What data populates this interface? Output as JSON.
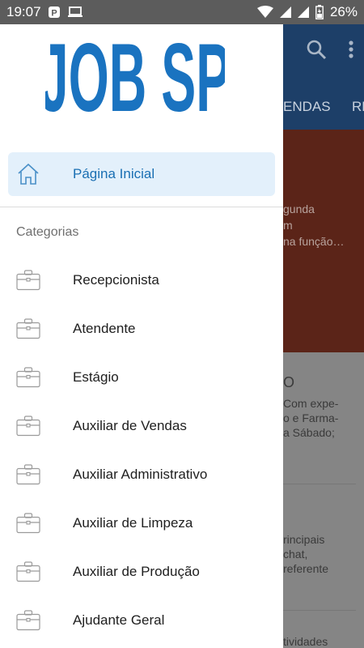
{
  "status_bar": {
    "time": "19:07",
    "battery": "26%",
    "icons": [
      "p-icon",
      "monitor-icon",
      "wifi-icon",
      "signal-icon",
      "signal-icon",
      "battery-icon"
    ]
  },
  "background_app": {
    "tabs": [
      "ENDAS",
      "RE"
    ],
    "hero_lines": [
      "gunda",
      "m",
      "na função…"
    ],
    "card1_lines": [
      "O",
      "Com expe-",
      "o e Farma-",
      "a Sábado;"
    ],
    "card2_lines": [
      "rincipais",
      "chat,",
      "referente"
    ],
    "card3_lines": [
      "tividades"
    ],
    "toolbar_icons": [
      "search-icon",
      "more-vert-icon"
    ]
  },
  "drawer": {
    "logo_text": "JOB SP",
    "logo_color": "#1a73c0",
    "home_label": "Página Inicial",
    "section_title": "Categorias",
    "categories": [
      "Recepcionista",
      "Atendente",
      "Estágio",
      "Auxiliar de Vendas",
      "Auxiliar Administrativo",
      "Auxiliar de Limpeza",
      "Auxiliar de Produção",
      "Ajudante Geral"
    ],
    "accent": "#1a6fb3",
    "highlight_bg": "#e3f0fb"
  }
}
